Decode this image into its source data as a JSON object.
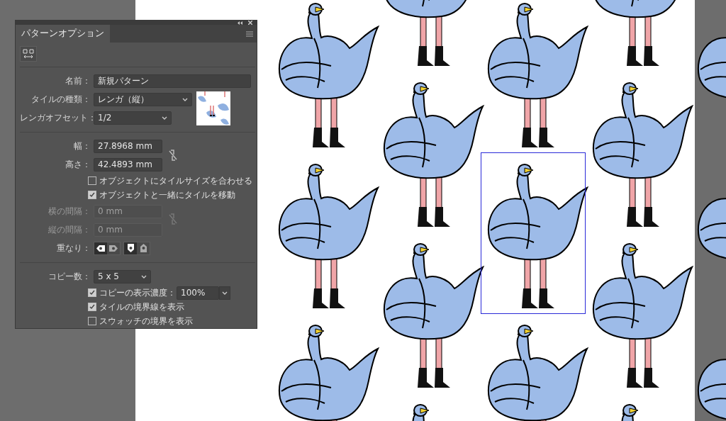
{
  "panel": {
    "tab": {
      "label": "パターンオプション",
      "selected": true
    },
    "name": {
      "label": "名前：",
      "value": "新規パターン"
    },
    "tile_type": {
      "label": "タイルの種類：",
      "value": "レンガ（縦）"
    },
    "brick_offset": {
      "label": "レンガオフセット：",
      "value": "1/2"
    },
    "width": {
      "label": "幅：",
      "value": "27.8968 mm"
    },
    "height": {
      "label": "高さ：",
      "value": "42.4893 mm"
    },
    "tile_checks": [
      {
        "label": "オブジェクトにタイルサイズを合わせる",
        "checked": false
      },
      {
        "label": "オブジェクトと一緒にタイルを移動",
        "checked": true
      }
    ],
    "spacing": [
      {
        "label": "横の間隔：",
        "value": "0 mm",
        "disabled": true
      },
      {
        "label": "縦の間隔：",
        "value": "0 mm",
        "disabled": true
      }
    ],
    "overlap": {
      "label": "重なり：",
      "horizontal": [
        {
          "selected": true
        },
        {
          "selected": false
        }
      ],
      "vertical": [
        {
          "selected": true
        },
        {
          "selected": false
        }
      ]
    },
    "copies": {
      "label": "コピー数：",
      "value": "5 x 5"
    },
    "copy_opacity": {
      "label": "コピーの表示濃度：",
      "checked": true,
      "value": "100%"
    },
    "display_checks": [
      {
        "label": "タイルの境界線を表示",
        "checked": true
      },
      {
        "label": "スウォッチの境界を表示",
        "checked": false
      }
    ]
  }
}
